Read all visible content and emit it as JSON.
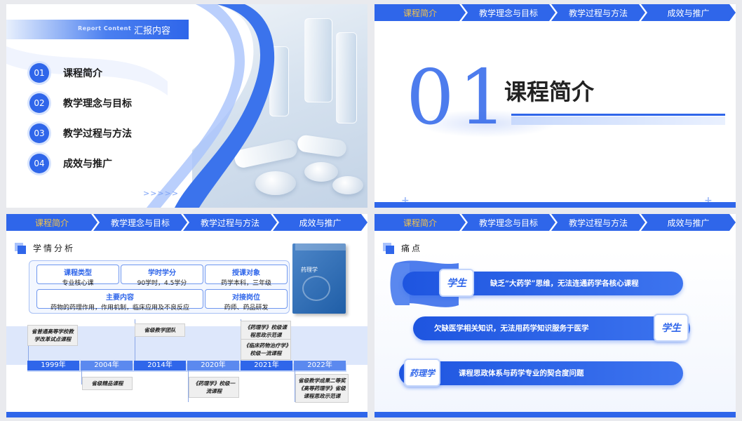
{
  "nav": [
    "课程简介",
    "教学理念与目标",
    "教学过程与方法",
    "成效与推广"
  ],
  "slide1": {
    "header_en": "Report Content",
    "header_zh": "汇报内容",
    "items": [
      {
        "num": "01",
        "label": "课程简介"
      },
      {
        "num": "02",
        "label": "教学理念与目标"
      },
      {
        "num": "03",
        "label": "教学过程与方法"
      },
      {
        "num": "04",
        "label": "成效与推广"
      }
    ],
    "arrows": ">>>>>"
  },
  "slide2": {
    "number": "01",
    "title": "课程简介"
  },
  "slide3": {
    "section_title": "学情分析",
    "boxes": [
      {
        "head": "课程类型",
        "value": "专业核心课"
      },
      {
        "head": "学时学分",
        "value": "90学时，4.5学分"
      },
      {
        "head": "授课对象",
        "value": "药学本科，三年级"
      },
      {
        "head": "主要内容",
        "value": "药物的药理作用，作用机制，临床应用及不良反应"
      },
      {
        "head": "对接岗位",
        "value": "药师、药品研发"
      }
    ],
    "book_title": "药理学",
    "timeline": [
      {
        "year": "1999年",
        "card": "省普通高等学校教学改革试点课程"
      },
      {
        "year": "2004年",
        "card": "省级精品课程"
      },
      {
        "year": "2014年",
        "card": "省级教学团队"
      },
      {
        "year": "2020年",
        "card": "《药理学》校级一流课程"
      },
      {
        "year": "2021年",
        "card_a": "《药理学》校级课程思政示范课",
        "card_b": "《临床药物治疗学》校级一流课程"
      },
      {
        "year": "2022年",
        "card": "省级教学成果二等奖《高等药理学》省级课程思政示范课"
      }
    ]
  },
  "slide4": {
    "section_title": "痛点",
    "points": [
      {
        "badge": "学生",
        "text": "缺乏“大药学”思维，无法连通药学各核心课程"
      },
      {
        "badge": "学生",
        "text": "欠缺医学相关知识，无法用药学知识服务于医学"
      },
      {
        "badge": "药理学",
        "text": "课程思政体系与药学专业的契合度问题"
      }
    ]
  },
  "colors": {
    "primary": "#2f66ea",
    "accent": "#f3c34a"
  }
}
